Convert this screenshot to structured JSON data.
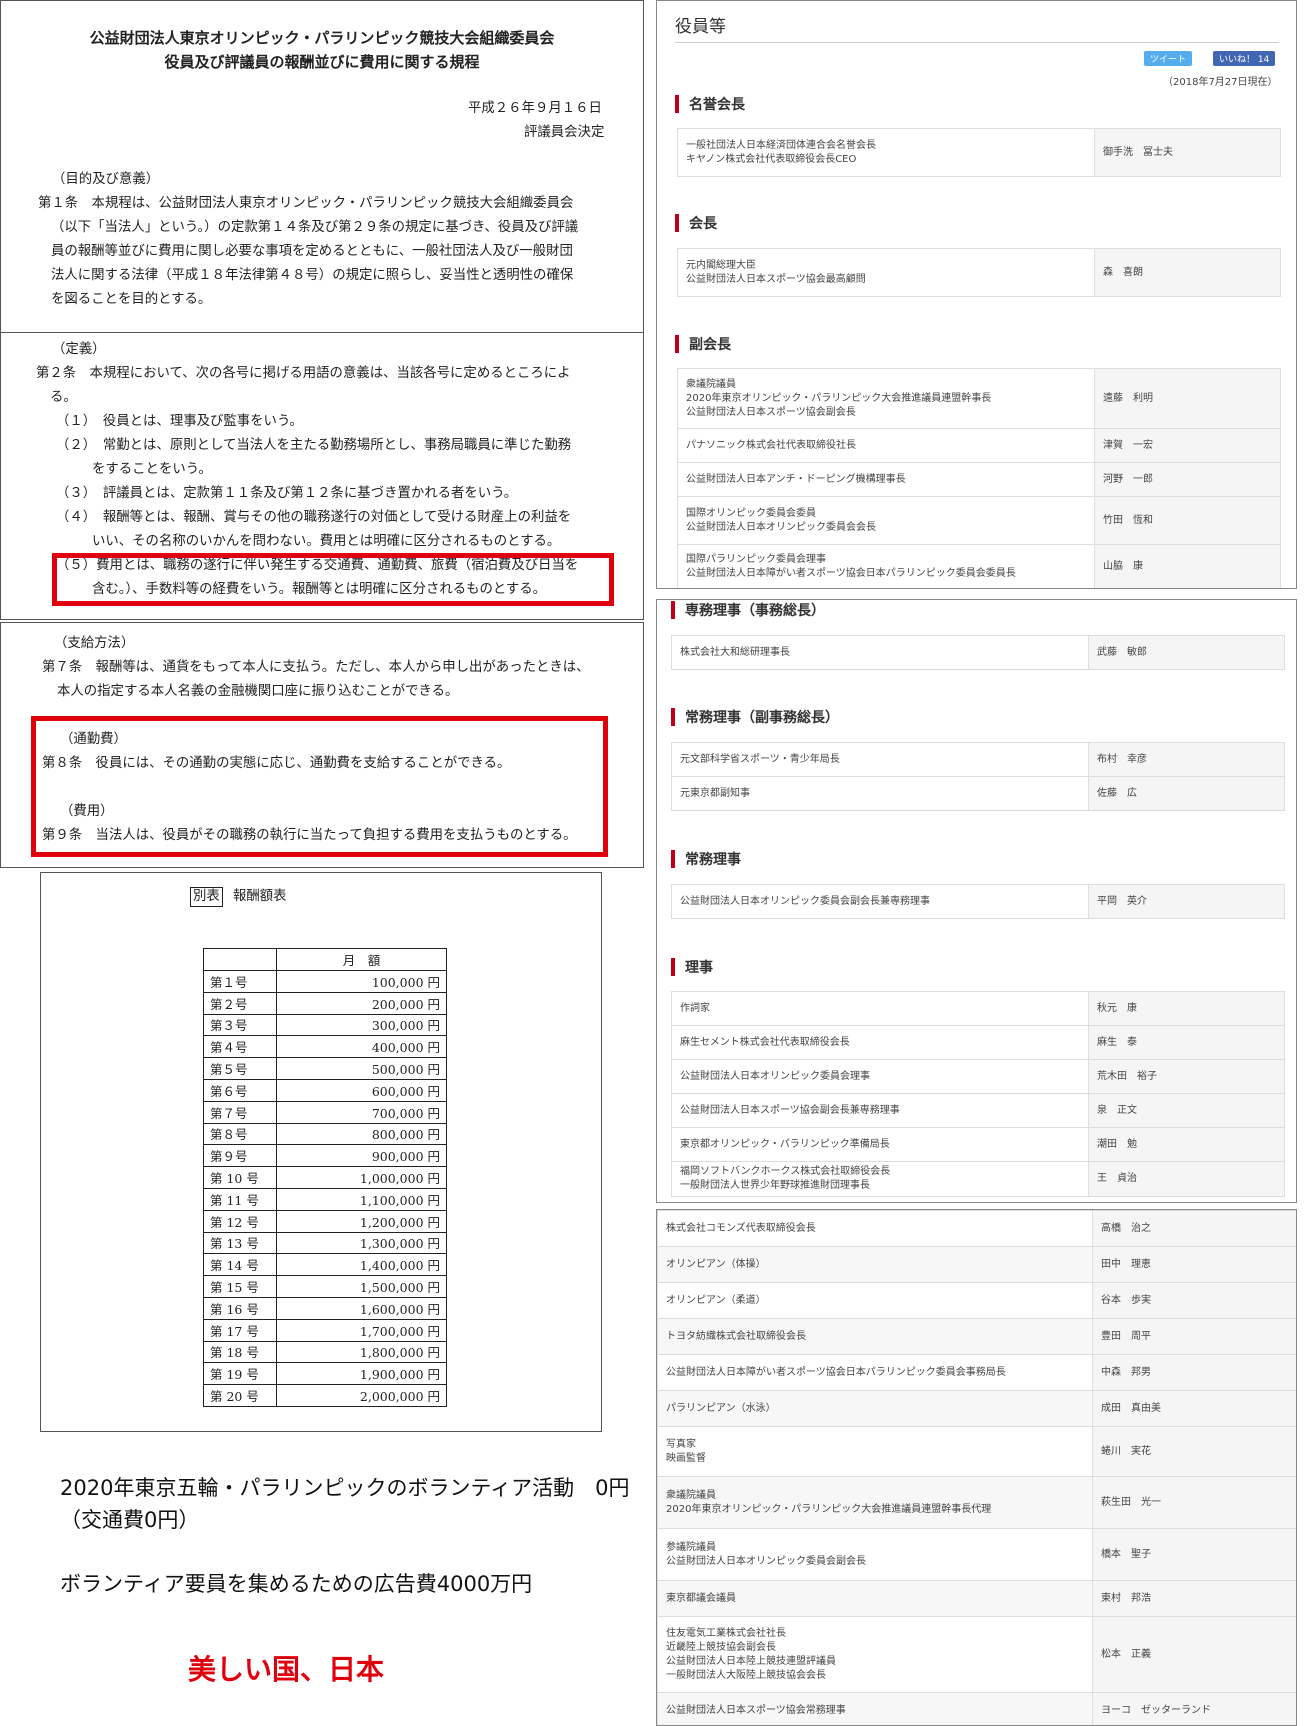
{
  "regulation": {
    "title_line1": "公益財団法人東京オリンピック・パラリンピック競技大会組織委員会",
    "title_line2": "役員及び評議員の報酬並びに費用に関する規程",
    "date": "平成２６年９月１６日",
    "decided_by": "評議員会決定",
    "art1_heading": "（目的及び意義）",
    "art1_lines": [
      "第１条　本規程は、公益財団法人東京オリンピック・パラリンピック競技大会組織委員会",
      "（以下「当法人」という。）の定款第１４条及び第２９条の規定に基づき、役員及び評議",
      "員の報酬等並びに費用に関し必要な事項を定めるとともに、一般社団法人及び一般財団",
      "法人に関する法律（平成１８年法律第４８号）の規定に照らし、妥当性と透明性の確保",
      "を図ることを目的とする。"
    ],
    "art2_heading": "（定義）",
    "art2_lines": [
      "第２条　本規程において、次の各号に掲げる用語の意義は、当該各号に定めるところによ",
      "る。",
      "（１）　役員とは、理事及び監事をいう。",
      "（２）　常勤とは、原則として当法人を主たる勤務場所とし、事務局職員に準じた勤務",
      "をすることをいう。",
      "（３）　評議員とは、定款第１１条及び第１２条に基づき置かれる者をいう。",
      "（４）　報酬等とは、報酬、賞与その他の職務遂行の対価として受ける財産上の利益を",
      "いい、その名称のいかんを問わない。費用とは明確に区分されるものとする。",
      "（５）費用とは、職務の遂行に伴い発生する交通費、通勤費、旅費（宿泊費及び日当を",
      "含む。）、手数料等の経費をいう。報酬等とは明確に区分されるものとする。"
    ],
    "art7_heading": "（支給方法）",
    "art7_lines": [
      "第７条　報酬等は、通貨をもって本人に支払う。ただし、本人から申し出があったときは、",
      "本人の指定する本人名義の金融機関口座に振り込むことができる。"
    ],
    "art8_heading": "（通勤費）",
    "art8_text": "第８条　役員には、その通勤の実態に応じ、通勤費を支給することができる。",
    "art9_heading": "（費用）",
    "art9_text": "第９条　当法人は、役員がその職務の執行に当たって負担する費用を支払うものとする。"
  },
  "salary_table": {
    "tag": "別表",
    "title": "報酬額表",
    "col_header": "月　額",
    "rows": [
      [
        "第１号",
        "100,000 円"
      ],
      [
        "第２号",
        "200,000 円"
      ],
      [
        "第３号",
        "300,000 円"
      ],
      [
        "第４号",
        "400,000 円"
      ],
      [
        "第５号",
        "500,000 円"
      ],
      [
        "第６号",
        "600,000 円"
      ],
      [
        "第７号",
        "700,000 円"
      ],
      [
        "第８号",
        "800,000 円"
      ],
      [
        "第９号",
        "900,000 円"
      ],
      [
        "第 10 号",
        "1,000,000 円"
      ],
      [
        "第 11 号",
        "1,100,000 円"
      ],
      [
        "第 12 号",
        "1,200,000 円"
      ],
      [
        "第 13 号",
        "1,300,000 円"
      ],
      [
        "第 14 号",
        "1,400,000 円"
      ],
      [
        "第 15 号",
        "1,500,000 円"
      ],
      [
        "第 16 号",
        "1,600,000 円"
      ],
      [
        "第 17 号",
        "1,700,000 円"
      ],
      [
        "第 18 号",
        "1,800,000 円"
      ],
      [
        "第 19 号",
        "1,900,000 円"
      ],
      [
        "第 20 号",
        "2,000,000 円"
      ]
    ]
  },
  "captions": {
    "line1": "2020年東京五輪・パラリンピックのボランティア活動　0円",
    "line2": "（交通費0円）",
    "line3": "ボランティア要員を集めるための広告費4000万円",
    "slogan": "美しい国、日本"
  },
  "officers": {
    "page_title": "役員等",
    "tweet_label": "ツイート",
    "like_label": "いいね！ 14",
    "as_of": "（2018年7月27日現在）",
    "honorary_heading": "名誉会長",
    "honorary": [
      [
        "一般社団法人日本経済団体連合会名誉会長\nキヤノン株式会社代表取締役会長CEO",
        "御手洗　冨士夫"
      ]
    ],
    "president_heading": "会長",
    "president": [
      [
        "元内閣総理大臣\n公益財団法人日本スポーツ協会最高顧問",
        "森　喜朗"
      ]
    ],
    "vice_heading": "副会長",
    "vice": [
      [
        "衆議院議員\n2020年東京オリンピック・パラリンピック大会推進議員連盟幹事長\n公益財団法人日本スポーツ協会副会長",
        "遠藤　利明"
      ],
      [
        "パナソニック株式会社代表取締役社長",
        "津賀　一宏"
      ],
      [
        "公益財団法人日本アンチ・ドーピング機構理事長",
        "河野　一郎"
      ],
      [
        "国際オリンピック委員会委員\n公益財団法人日本オリンピック委員会会長",
        "竹田　恆和"
      ],
      [
        "国際パラリンピック委員会理事\n公益財団法人日本障がい者スポーツ協会日本パラリンピック委員会委員長",
        "山脇　康"
      ]
    ],
    "secgen_heading": "専務理事（事務総長）",
    "secgen": [
      [
        "株式会社大和総研理事長",
        "武藤　敏郎"
      ]
    ],
    "deputy_heading": "常務理事（副事務総長）",
    "deputy": [
      [
        "元文部科学省スポーツ・青少年局長",
        "布村　幸彦"
      ],
      [
        "元東京都副知事",
        "佐藤　広"
      ]
    ],
    "managing_heading": "常務理事",
    "managing": [
      [
        "公益財団法人日本オリンピック委員会副会長兼専務理事",
        "平岡　英介"
      ]
    ],
    "directors_heading": "理事",
    "directors": [
      [
        "作詞家",
        "秋元　康"
      ],
      [
        "麻生セメント株式会社代表取締役会長",
        "麻生　泰"
      ],
      [
        "公益財団法人日本オリンピック委員会理事",
        "荒木田　裕子"
      ],
      [
        "公益財団法人日本スポーツ協会副会長兼専務理事",
        "泉　正文"
      ],
      [
        "東京都オリンピック・パラリンピック準備局長",
        "潮田　勉"
      ],
      [
        "福岡ソフトバンクホークス株式会社取締役会長\n一般財団法人世界少年野球推進財団理事長",
        "王　貞治"
      ]
    ],
    "directors_cont": [
      [
        "株式会社コモンズ代表取締役会長",
        "高橋　治之"
      ],
      [
        "オリンピアン（体操）",
        "田中　理恵"
      ],
      [
        "オリンピアン（柔道）",
        "谷本　歩実"
      ],
      [
        "トヨタ紡織株式会社取締役会長",
        "豊田　周平"
      ],
      [
        "公益財団法人日本障がい者スポーツ協会日本パラリンピック委員会事務局長",
        "中森　邦男"
      ],
      [
        "パラリンピアン（水泳）",
        "成田　真由美"
      ],
      [
        "写真家\n映画監督",
        "蜷川　実花"
      ],
      [
        "衆議院議員\n2020年東京オリンピック・パラリンピック大会推進議員連盟幹事長代理",
        "萩生田　光一"
      ],
      [
        "参議院議員\n公益財団法人日本オリンピック委員会副会長",
        "橋本　聖子"
      ],
      [
        "東京都議会議員",
        "東村　邦浩"
      ],
      [
        "住友電気工業株式会社社長\n近畿陸上競技協会副会長\n公益財団法人日本陸上競技連盟評議員\n一般財団法人大阪陸上競技協会会長",
        "松本　正義"
      ],
      [
        "公益財団法人日本スポーツ協会常務理事",
        "ヨーコ　ゼッターランド"
      ]
    ]
  }
}
